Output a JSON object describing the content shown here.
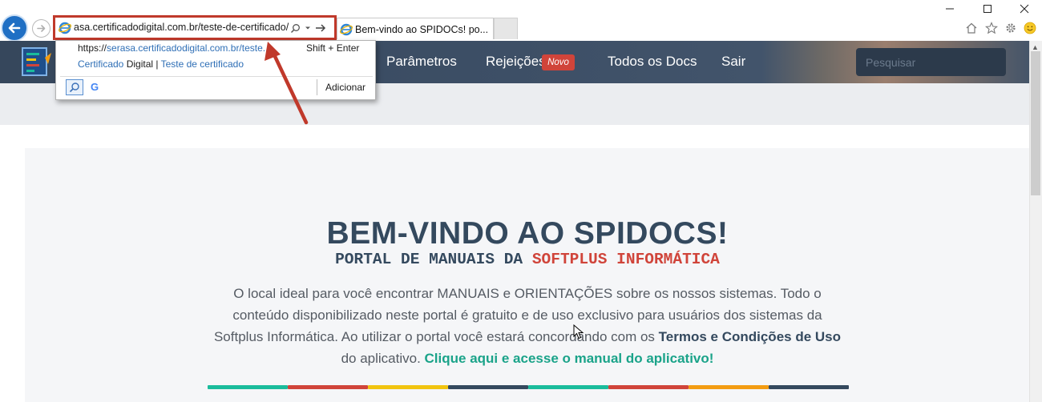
{
  "browser": {
    "address_url": "asa.certificadodigital.com.br/teste-de-certificado/",
    "tab_title": "Bem-vindo ao SPIDOCs! po...",
    "icons": [
      "back-arrow-icon",
      "forward-arrow-icon",
      "ie-logo-icon",
      "search-icon",
      "dropdown-arrow-icon",
      "go-arrow-icon",
      "home-icon",
      "favorites-star-icon",
      "settings-gear-icon",
      "smiley-feedback-icon",
      "minimize-icon",
      "maximize-icon",
      "close-icon"
    ],
    "autocomplete": {
      "url_prefix": "https://",
      "url_highlight": "serasa.certificadodigital.com.br/teste...",
      "shortcut": "Shift + Enter",
      "title_part1": "Certificado",
      "title_part2": " Digital | ",
      "title_part3": "Teste de certificado",
      "provider": "G",
      "add_label": "Adicionar"
    },
    "accent_color": "#c0392b"
  },
  "nav": {
    "items": [
      {
        "label": "Parâmetros"
      },
      {
        "label": "Rejeições"
      },
      {
        "label": "Todos os Docs"
      },
      {
        "label": "Sair"
      }
    ],
    "badge": "Novo",
    "search_placeholder": "Pesquisar"
  },
  "content": {
    "title": "BEM-VINDO AO SPIDOCS!",
    "subtitle_part1": "PORTAL DE MANUAIS DA ",
    "subtitle_part2": "SOFTPLUS INFORMÁTICA",
    "para_part1": "O local ideal para você encontrar MANUAIS e ORIENTAÇÕES sobre os nossos sistemas. Todo o conteúdo disponibilizado neste portal é gratuito e de uso exclusivo para usuários dos sistemas da Softplus Informática. Ao utilizar o portal você estará concordando com os ",
    "para_terms": "Termos e Condições de Uso",
    "para_part2": " do aplicativo. ",
    "para_link": "Clique aqui e acesse o manual do aplicativo!",
    "colorbar_colors": [
      "#1abc9c",
      "#d0443a",
      "#f1c40f",
      "#34495e",
      "#1abc9c",
      "#d0443a",
      "#f39c12",
      "#34495e"
    ]
  }
}
